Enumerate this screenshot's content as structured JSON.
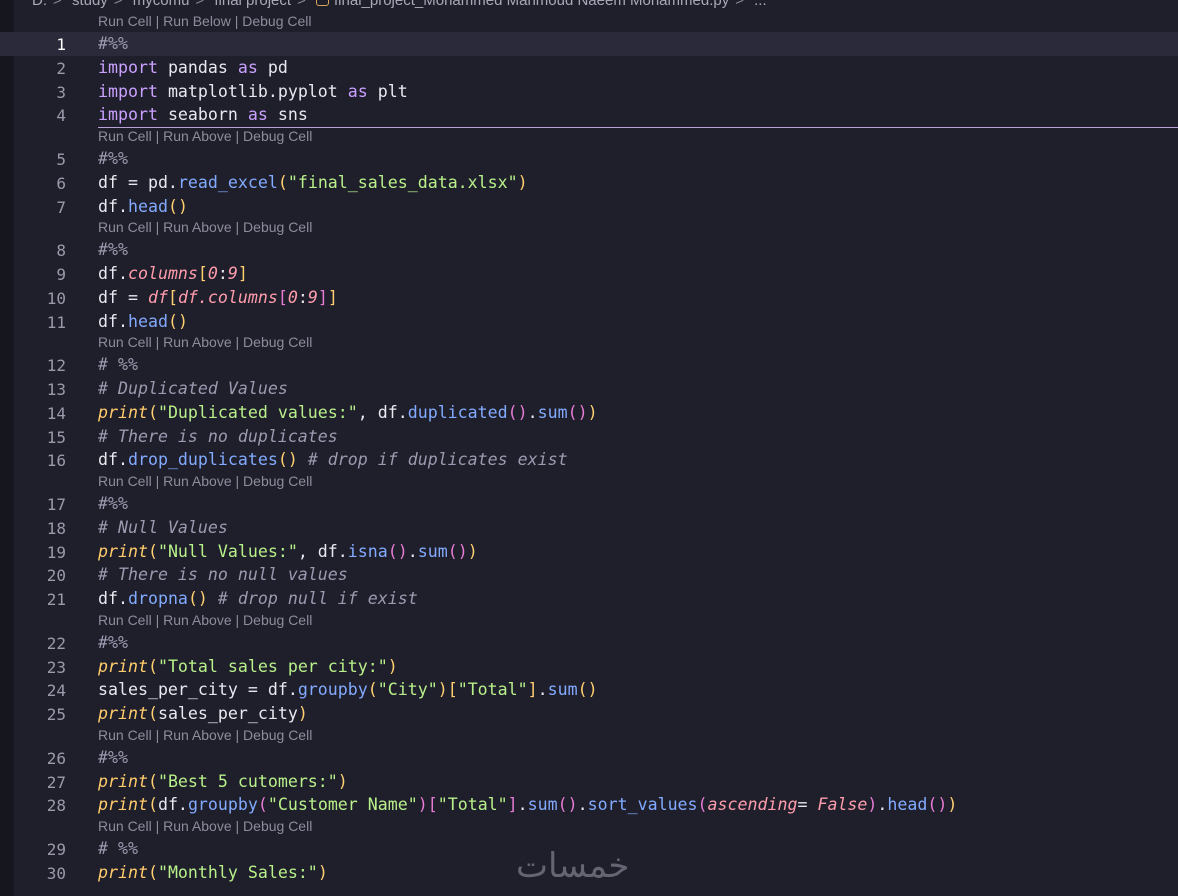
{
  "breadcrumb": {
    "drive": "D:",
    "parts": [
      "study",
      "mycomu",
      "final project"
    ],
    "file": "final_project_Mohammed Mahmoud Naeem Mohammed.py",
    "tail": "..."
  },
  "codelens": {
    "first": [
      "Run Cell",
      "Run Below",
      "Debug Cell"
    ],
    "rest": [
      "Run Cell",
      "Run Above",
      "Debug Cell"
    ]
  },
  "lines": [
    {
      "n": "1",
      "tokens": [
        {
          "t": "#%%",
          "c": "cmt"
        }
      ]
    },
    {
      "n": "2",
      "tokens": [
        {
          "t": "import",
          "c": "kw"
        },
        {
          "t": " pandas ",
          "c": "plain"
        },
        {
          "t": "as",
          "c": "kw"
        },
        {
          "t": " pd",
          "c": "plain"
        }
      ]
    },
    {
      "n": "3",
      "tokens": [
        {
          "t": "import",
          "c": "kw"
        },
        {
          "t": " matplotlib.pyplot ",
          "c": "plain"
        },
        {
          "t": "as",
          "c": "kw"
        },
        {
          "t": " plt",
          "c": "plain"
        }
      ]
    },
    {
      "n": "4",
      "tokens": [
        {
          "t": "import",
          "c": "kw"
        },
        {
          "t": " seaborn ",
          "c": "plain"
        },
        {
          "t": "as",
          "c": "kw"
        },
        {
          "t": " sns",
          "c": "plain"
        }
      ]
    },
    {
      "n": "5",
      "tokens": [
        {
          "t": "#%%",
          "c": "cmt"
        }
      ]
    },
    {
      "n": "6",
      "tokens": [
        {
          "t": "df = pd.",
          "c": "plain"
        },
        {
          "t": "read_excel",
          "c": "fn"
        },
        {
          "t": "(",
          "c": "p1"
        },
        {
          "t": "\"final_sales_data.xlsx\"",
          "c": "str"
        },
        {
          "t": ")",
          "c": "p1"
        }
      ]
    },
    {
      "n": "7",
      "tokens": [
        {
          "t": "df.",
          "c": "plain"
        },
        {
          "t": "head",
          "c": "fn"
        },
        {
          "t": "()",
          "c": "p1"
        }
      ]
    },
    {
      "n": "8",
      "tokens": [
        {
          "t": "#%%",
          "c": "cmt"
        }
      ]
    },
    {
      "n": "9",
      "tokens": [
        {
          "t": "df.",
          "c": "plain"
        },
        {
          "t": "columns",
          "c": "attr"
        },
        {
          "t": "[",
          "c": "p1"
        },
        {
          "t": "0",
          "c": "num"
        },
        {
          "t": ":",
          "c": "plain"
        },
        {
          "t": "9",
          "c": "num"
        },
        {
          "t": "]",
          "c": "p1"
        }
      ]
    },
    {
      "n": "10",
      "tokens": [
        {
          "t": "df = ",
          "c": "plain"
        },
        {
          "t": "df",
          "c": "attr"
        },
        {
          "t": "[",
          "c": "p1"
        },
        {
          "t": "df.",
          "c": "attr"
        },
        {
          "t": "columns",
          "c": "attr"
        },
        {
          "t": "[",
          "c": "p2"
        },
        {
          "t": "0",
          "c": "num"
        },
        {
          "t": ":",
          "c": "plain"
        },
        {
          "t": "9",
          "c": "num"
        },
        {
          "t": "]",
          "c": "p2"
        },
        {
          "t": "]",
          "c": "p1"
        }
      ]
    },
    {
      "n": "11",
      "tokens": [
        {
          "t": "df.",
          "c": "plain"
        },
        {
          "t": "head",
          "c": "fn"
        },
        {
          "t": "()",
          "c": "p1"
        }
      ]
    },
    {
      "n": "12",
      "tokens": [
        {
          "t": "# %%",
          "c": "cmt"
        }
      ]
    },
    {
      "n": "13",
      "tokens": [
        {
          "t": "# Duplicated Values",
          "c": "cmt"
        }
      ]
    },
    {
      "n": "14",
      "tokens": [
        {
          "t": "print",
          "c": "bi"
        },
        {
          "t": "(",
          "c": "p1"
        },
        {
          "t": "\"Duplicated values:\"",
          "c": "str"
        },
        {
          "t": ", df.",
          "c": "plain"
        },
        {
          "t": "duplicated",
          "c": "fn"
        },
        {
          "t": "()",
          "c": "p2"
        },
        {
          "t": ".",
          "c": "plain"
        },
        {
          "t": "sum",
          "c": "fn"
        },
        {
          "t": "()",
          "c": "p2"
        },
        {
          "t": ")",
          "c": "p1"
        }
      ]
    },
    {
      "n": "15",
      "tokens": [
        {
          "t": "# There is no duplicates",
          "c": "cmt"
        }
      ]
    },
    {
      "n": "16",
      "tokens": [
        {
          "t": "df.",
          "c": "plain"
        },
        {
          "t": "drop_duplicates",
          "c": "fn"
        },
        {
          "t": "()",
          "c": "p1"
        },
        {
          "t": " # drop if duplicates exist",
          "c": "cmt"
        }
      ]
    },
    {
      "n": "17",
      "tokens": [
        {
          "t": "#%%",
          "c": "cmt"
        }
      ]
    },
    {
      "n": "18",
      "tokens": [
        {
          "t": "# Null Values",
          "c": "cmt"
        }
      ]
    },
    {
      "n": "19",
      "tokens": [
        {
          "t": "print",
          "c": "bi"
        },
        {
          "t": "(",
          "c": "p1"
        },
        {
          "t": "\"Null Values:\"",
          "c": "str"
        },
        {
          "t": ", df.",
          "c": "plain"
        },
        {
          "t": "isna",
          "c": "fn"
        },
        {
          "t": "()",
          "c": "p2"
        },
        {
          "t": ".",
          "c": "plain"
        },
        {
          "t": "sum",
          "c": "fn"
        },
        {
          "t": "()",
          "c": "p2"
        },
        {
          "t": ")",
          "c": "p1"
        }
      ]
    },
    {
      "n": "20",
      "tokens": [
        {
          "t": "# There is no null values",
          "c": "cmt"
        }
      ]
    },
    {
      "n": "21",
      "tokens": [
        {
          "t": "df.",
          "c": "plain"
        },
        {
          "t": "dropna",
          "c": "fn"
        },
        {
          "t": "()",
          "c": "p1"
        },
        {
          "t": " # drop null if exist",
          "c": "cmt"
        }
      ]
    },
    {
      "n": "22",
      "tokens": [
        {
          "t": "#%%",
          "c": "cmt"
        }
      ]
    },
    {
      "n": "23",
      "tokens": [
        {
          "t": "print",
          "c": "bi"
        },
        {
          "t": "(",
          "c": "p1"
        },
        {
          "t": "\"Total sales per city:\"",
          "c": "str"
        },
        {
          "t": ")",
          "c": "p1"
        }
      ]
    },
    {
      "n": "24",
      "tokens": [
        {
          "t": "sales_per_city = df.",
          "c": "plain"
        },
        {
          "t": "groupby",
          "c": "fn"
        },
        {
          "t": "(",
          "c": "p1"
        },
        {
          "t": "\"City\"",
          "c": "str"
        },
        {
          "t": ")",
          "c": "p1"
        },
        {
          "t": "[",
          "c": "p1"
        },
        {
          "t": "\"Total\"",
          "c": "str"
        },
        {
          "t": "]",
          "c": "p1"
        },
        {
          "t": ".",
          "c": "plain"
        },
        {
          "t": "sum",
          "c": "fn"
        },
        {
          "t": "()",
          "c": "p1"
        }
      ]
    },
    {
      "n": "25",
      "tokens": [
        {
          "t": "print",
          "c": "bi"
        },
        {
          "t": "(",
          "c": "p1"
        },
        {
          "t": "sales_per_city",
          "c": "plain"
        },
        {
          "t": ")",
          "c": "p1"
        }
      ]
    },
    {
      "n": "26",
      "tokens": [
        {
          "t": "#%%",
          "c": "cmt"
        }
      ]
    },
    {
      "n": "27",
      "tokens": [
        {
          "t": "print",
          "c": "bi"
        },
        {
          "t": "(",
          "c": "p1"
        },
        {
          "t": "\"Best 5 cutomers:\"",
          "c": "str"
        },
        {
          "t": ")",
          "c": "p1"
        }
      ]
    },
    {
      "n": "28",
      "tokens": [
        {
          "t": "print",
          "c": "bi"
        },
        {
          "t": "(",
          "c": "p1"
        },
        {
          "t": "df.",
          "c": "plain"
        },
        {
          "t": "groupby",
          "c": "fn"
        },
        {
          "t": "(",
          "c": "p2"
        },
        {
          "t": "\"Customer Name\"",
          "c": "str"
        },
        {
          "t": ")",
          "c": "p2"
        },
        {
          "t": "[",
          "c": "p2"
        },
        {
          "t": "\"Total\"",
          "c": "str"
        },
        {
          "t": "]",
          "c": "p2"
        },
        {
          "t": ".",
          "c": "plain"
        },
        {
          "t": "sum",
          "c": "fn"
        },
        {
          "t": "()",
          "c": "p2"
        },
        {
          "t": ".",
          "c": "plain"
        },
        {
          "t": "sort_values",
          "c": "fn"
        },
        {
          "t": "(",
          "c": "p2"
        },
        {
          "t": "ascending",
          "c": "attr"
        },
        {
          "t": "= ",
          "c": "plain"
        },
        {
          "t": "False",
          "c": "num"
        },
        {
          "t": ")",
          "c": "p2"
        },
        {
          "t": ".",
          "c": "plain"
        },
        {
          "t": "head",
          "c": "fn"
        },
        {
          "t": "()",
          "c": "p2"
        },
        {
          "t": ")",
          "c": "p1"
        }
      ]
    },
    {
      "n": "29",
      "tokens": [
        {
          "t": "# %%",
          "c": "cmt"
        }
      ]
    },
    {
      "n": "30",
      "tokens": [
        {
          "t": "print",
          "c": "bi"
        },
        {
          "t": "(",
          "c": "p1"
        },
        {
          "t": "\"Monthly Sales:\"",
          "c": "str"
        },
        {
          "t": ")",
          "c": "p1"
        }
      ]
    }
  ],
  "watermark": "خمسات",
  "status_fragment": "Monthly Sales: ... ... ... ..."
}
